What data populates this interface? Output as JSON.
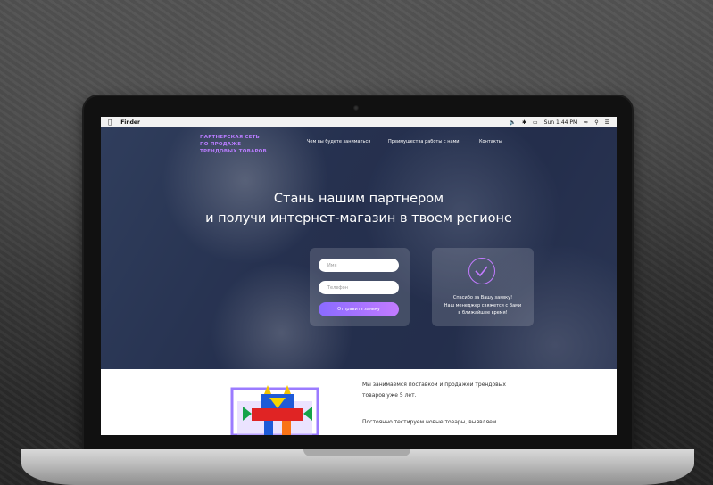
{
  "menubar": {
    "app_name": "Finder",
    "clock": "Sun 1:44 PM",
    "icons": [
      "apple-icon",
      "volume-icon",
      "bluetooth-icon",
      "battery-icon",
      "wifi-icon",
      "search-icon",
      "list-icon"
    ]
  },
  "site": {
    "logo_lines": [
      "ПАРТНЕРСКАЯ СЕТЬ",
      "ПО ПРОДАЖЕ",
      "ТРЕНДОВЫХ ТОВАРОВ"
    ],
    "nav": [
      "Чем вы будете заниматься",
      "Преимущества работы с нами",
      "Контакты"
    ]
  },
  "hero": {
    "title_line1": "Стань нашим партнером",
    "title_line2": "и получи интернет-магазин в твоем регионе"
  },
  "form": {
    "name_placeholder": "Имя",
    "phone_placeholder": "Телефон",
    "submit_label": "Отправить заявку"
  },
  "thanks": {
    "line1": "Спасибо за Вашу заявку!",
    "line2": "Наш менеджер свяжется с Вами",
    "line3": "в ближайшее время!"
  },
  "content": {
    "para_line1": "Мы занимаемся поставкой и продажей трендовых",
    "para_line2": "товаров уже 5 лет.",
    "para_line3": "Постоянно тестируем новые товары, выявляем"
  },
  "colors": {
    "accent": "#b97cff",
    "hero_bg": "#2b3655",
    "button_from": "#8a6bff",
    "button_to": "#c27bff"
  }
}
